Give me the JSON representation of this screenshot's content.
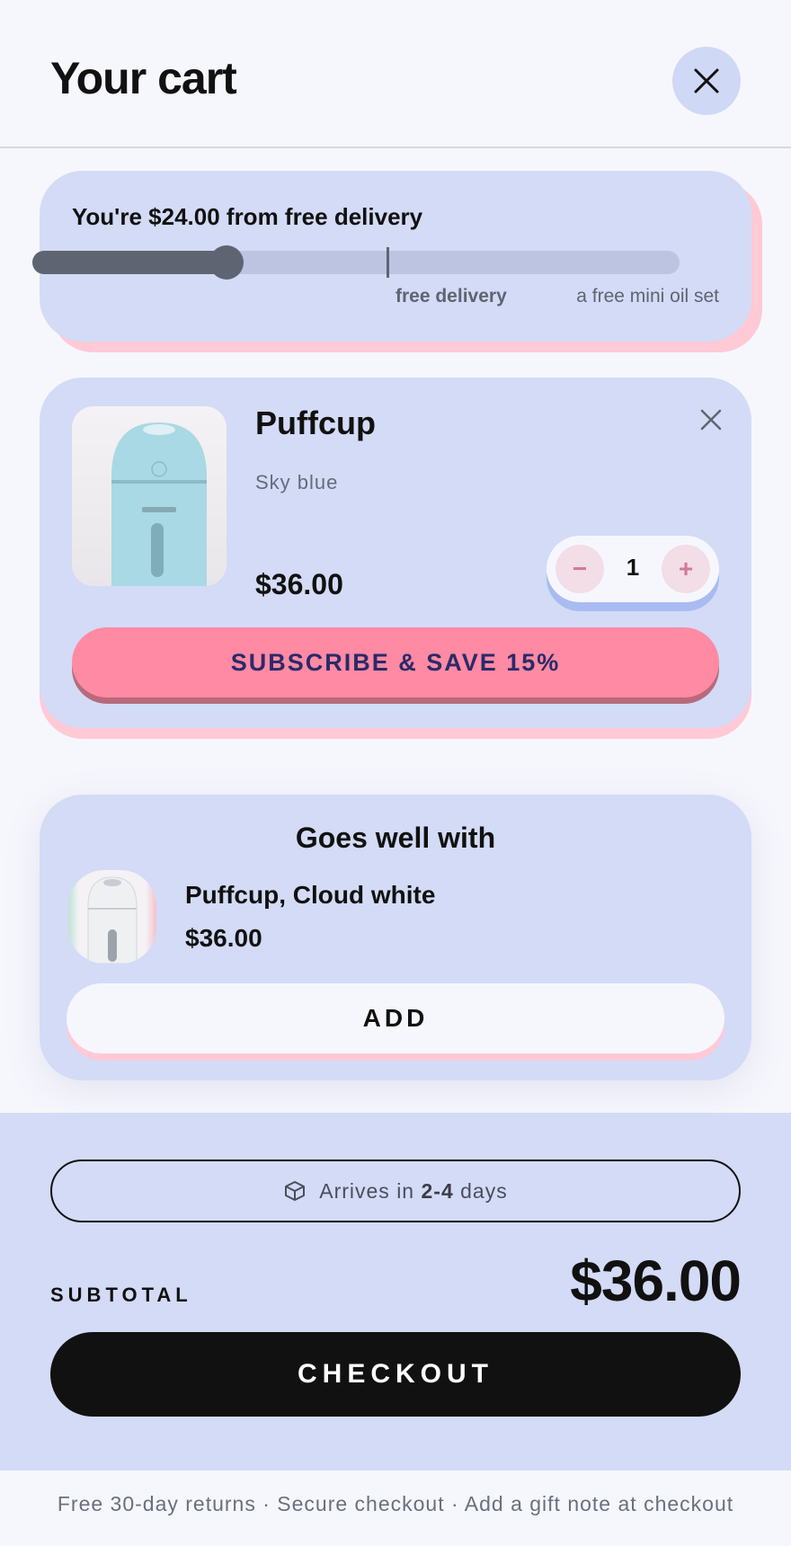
{
  "header": {
    "title": "Your cart",
    "close_icon": "close-icon"
  },
  "delivery": {
    "message": "You're $24.00 from free delivery",
    "progress_fraction": 0.3,
    "milestones": [
      {
        "label": "free delivery",
        "at_fraction": 0.5
      },
      {
        "label": "a free mini oil set",
        "at_fraction": 1.0
      }
    ],
    "colors": {
      "fill": "#5f6472",
      "track": "#bcc4e2"
    }
  },
  "cart_item": {
    "name": "Puffcup",
    "variant": "Sky blue",
    "price": "$36.00",
    "quantity": "1",
    "decrease_label": "−",
    "increase_label": "+",
    "subscribe_label": "SUBSCRIBE & SAVE 15%",
    "remove_icon": "close-icon"
  },
  "upsell": {
    "title": "Goes well with",
    "product_name": "Puffcup, Cloud white",
    "product_price": "$36.00",
    "add_label": "ADD"
  },
  "summary": {
    "arrives_prefix": "Arrives in",
    "arrives_range": "2-4",
    "arrives_suffix": "days",
    "box_icon": "box-icon",
    "subtotal_label": "SUBTOTAL",
    "subtotal_value": "$36.00",
    "checkout_label": "CHECKOUT"
  },
  "footer": {
    "note": "Free 30-day returns · Secure checkout · Add a gift note at checkout"
  },
  "colors": {
    "accent_pink": "#ff8aa3",
    "card_bg": "#d3dbf6",
    "page_bg": "#f6f7fd",
    "dark": "#111111"
  }
}
